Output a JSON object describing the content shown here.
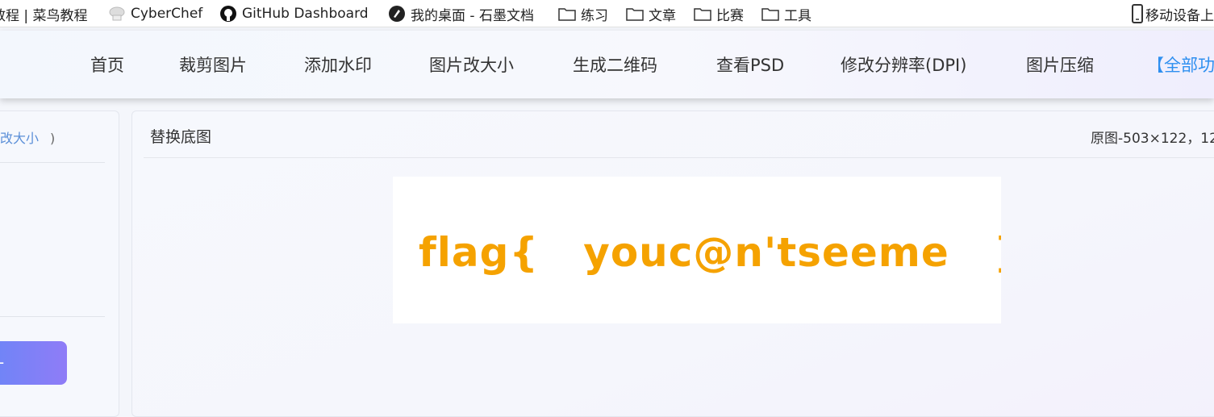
{
  "bookmarks": {
    "items": [
      {
        "label": "教程 | 菜鸟教程",
        "icon": "runoob-icon"
      },
      {
        "label": "CyberChef",
        "icon": "chef-hat-icon"
      },
      {
        "label": "GitHub Dashboard",
        "icon": "github-icon"
      },
      {
        "label": "我的桌面 - 石墨文档",
        "icon": "shimo-icon"
      },
      {
        "label": "练习",
        "icon": "folder-icon"
      },
      {
        "label": "文章",
        "icon": "folder-icon"
      },
      {
        "label": "比赛",
        "icon": "folder-icon"
      },
      {
        "label": "工具",
        "icon": "folder-icon"
      }
    ],
    "mobile_label": "移动设备上"
  },
  "nav": {
    "items": [
      "首页",
      "裁剪图片",
      "添加水印",
      "图片改大小",
      "生成二维码",
      "查看PSD",
      "修改分辨率(DPI)",
      "图片压缩"
    ],
    "all_label": "【全部功"
  },
  "left_panel": {
    "crumb_text": "改大小",
    "crumb_close": ")"
  },
  "main": {
    "title": "替换底图",
    "info": "原图-503×122，12",
    "preview_text": "flag{   youc@n'tseeme   }",
    "preview_color": "#f5a200"
  }
}
